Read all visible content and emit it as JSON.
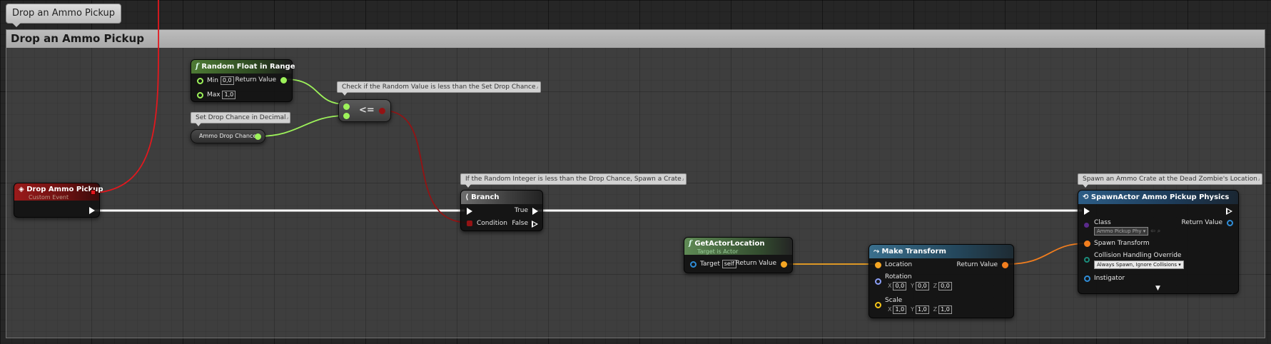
{
  "tab": {
    "title": "Drop an Ammo Pickup"
  },
  "comment_box": {
    "title": "Drop an Ammo Pickup"
  },
  "colors": {
    "exec_wire": "#ffffff",
    "float_pin": "#9df25a",
    "bool_pin": "#931314",
    "vector_pin": "#f5a623",
    "transform_pin": "#f27e1e",
    "object_pin": "#2f8dd8",
    "red_wire": "#e2181e"
  },
  "bubbles": {
    "compare": "Check if the Random Value is less than the Set Drop Chance",
    "drop_chance": "Set Drop Chance in Decimal",
    "branch": "If the Random Integer is less than the Drop Chance, Spawn a Crate",
    "spawn": "Spawn an Ammo Crate at the Dead Zombie's Location"
  },
  "random_float": {
    "icon": "function-icon",
    "title": "Random Float in Range",
    "min_label": "Min",
    "min_value": "0,0",
    "max_label": "Max",
    "max_value": "1,0",
    "return_label": "Return Value"
  },
  "compare_node": {
    "op": "<="
  },
  "drop_chance_var": {
    "label": "Ammo Drop Chance"
  },
  "custom_event": {
    "icon": "event-icon",
    "title": "Drop Ammo Pickup",
    "subtitle": "Custom Event"
  },
  "branch": {
    "icon": "branch-icon",
    "title": "Branch",
    "true_label": "True",
    "false_label": "False",
    "condition_label": "Condition"
  },
  "get_actor_location": {
    "icon": "function-icon",
    "title": "GetActorLocation",
    "subtitle": "Target is Actor",
    "target_label": "Target",
    "target_value": "self",
    "return_label": "Return Value"
  },
  "make_transform": {
    "icon": "transform-icon",
    "title": "Make Transform",
    "location_label": "Location",
    "rotation_label": "Rotation",
    "scale_label": "Scale",
    "return_label": "Return Value",
    "rotation": {
      "x": "0,0",
      "y": "0,0",
      "z": "0,0"
    },
    "scale": {
      "x": "1,0",
      "y": "1,0",
      "z": "1,0"
    },
    "axis_x": "X",
    "axis_y": "Y",
    "axis_z": "Z"
  },
  "spawn_actor": {
    "icon": "spawn-icon",
    "title": "SpawnActor Ammo Pickup Physics",
    "class_label": "Class",
    "class_value": "Ammo Pickup Phy",
    "return_label": "Return Value",
    "spawn_transform_label": "Spawn Transform",
    "collision_label": "Collision Handling Override",
    "collision_value": "Always Spawn, Ignore Collisions",
    "instigator_label": "Instigator"
  }
}
